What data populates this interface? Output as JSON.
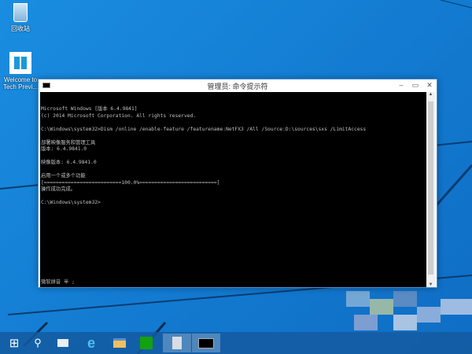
{
  "desktop": {
    "icons": [
      {
        "label": "回收站"
      },
      {
        "label": "Welcome to Tech Previ..."
      }
    ]
  },
  "window": {
    "title": "管理员: 命令提示符",
    "lines": [
      "Microsoft Windows [版本 6.4.9841]",
      "(c) 2014 Microsoft Corporation. All rights reserved.",
      "",
      "C:\\Windows\\system32>Dism /online /enable-feature /featurename:NetFX3 /All /Source:D:\\sources\\sxs /LimitAccess",
      "",
      "部署映像服务和管理工具",
      "版本: 6.4.9841.0",
      "",
      "映像版本: 6.4.9841.0",
      "",
      "启用一个或多个功能",
      "[==========================100.0%==========================]",
      "操作成功完成。",
      "",
      "C:\\Windows\\system32>"
    ],
    "ime_status": "微软拼音 半 ;"
  },
  "taskbar": {
    "items": [
      "start",
      "search",
      "task-view",
      "internet-explorer",
      "file-explorer",
      "store",
      "recycle-app",
      "command-prompt"
    ]
  }
}
